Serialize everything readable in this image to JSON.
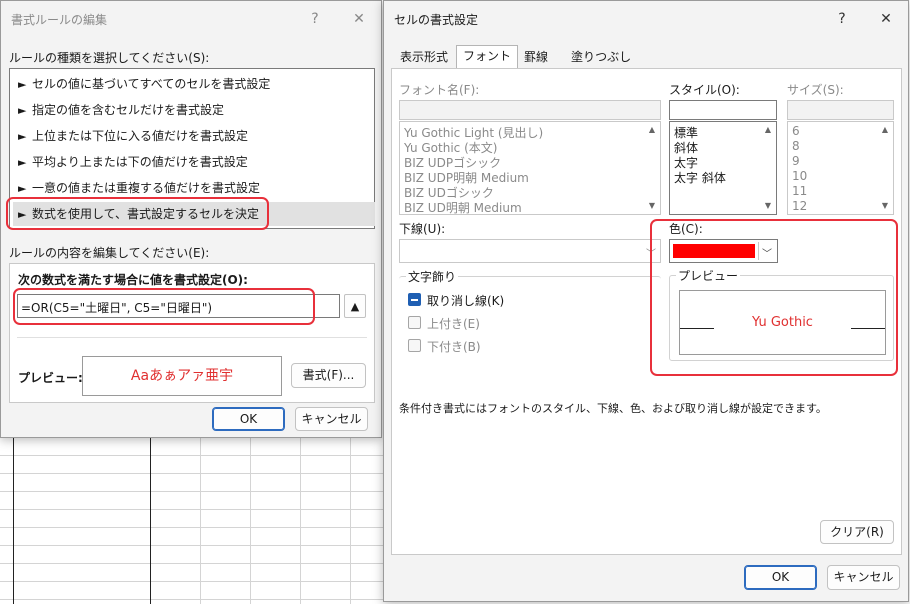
{
  "rule_dialog": {
    "title": "書式ルールの編集",
    "help": "?",
    "close": "✕",
    "rule_type_label": "ルールの種類を選択してください(S):",
    "rule_types": [
      "セルの値に基づいてすべてのセルを書式設定",
      "指定の値を含むセルだけを書式設定",
      "上位または下位に入る値だけを書式設定",
      "平均より上または下の値だけを書式設定",
      "一意の値または重複する値だけを書式設定",
      "数式を使用して、書式設定するセルを決定"
    ],
    "selected_index": 5,
    "edit_label": "ルールの内容を編集してください(E):",
    "formula_label": "次の数式を満たす場合に値を書式設定(O):",
    "formula_value": "=OR(C5=\"土曜日\", C5=\"日曜日\")",
    "preview_label": "プレビュー:",
    "preview_text": "Aaあぁアァ亜宇",
    "format_button": "書式(F)...",
    "ok": "OK",
    "cancel": "キャンセル"
  },
  "cell_dialog": {
    "title": "セルの書式設定",
    "help": "?",
    "close": "✕",
    "tabs": [
      "表示形式",
      "フォント",
      "罫線",
      "塗りつぶし"
    ],
    "active_tab": 1,
    "font_name_label": "フォント名(F):",
    "font_names": [
      "Yu Gothic Light (見出し)",
      "Yu Gothic (本文)",
      "BIZ UDPゴシック",
      "BIZ UDP明朝 Medium",
      "BIZ UDゴシック",
      "BIZ UD明朝 Medium"
    ],
    "style_label": "スタイル(O):",
    "styles": [
      "標準",
      "斜体",
      "太字",
      "太字 斜体"
    ],
    "size_label": "サイズ(S):",
    "sizes": [
      "6",
      "8",
      "9",
      "10",
      "11",
      "12"
    ],
    "underline_label": "下線(U):",
    "color_label": "色(C):",
    "color_value": "#ff0000",
    "effects_label": "文字飾り",
    "strikethrough_label": "取り消し線(K)",
    "superscript_label": "上付き(E)",
    "subscript_label": "下付き(B)",
    "preview_label": "プレビュー",
    "preview_text": "Yu Gothic",
    "info_text": "条件付き書式にはフォントのスタイル、下線、色、および取り消し線が設定できます。",
    "clear_button": "クリア(R)",
    "ok": "OK",
    "cancel": "キャンセル"
  },
  "colors": {
    "highlight_outline": "#e8303b",
    "preview_red": "#e03030",
    "accent_blue": "#1f5fb3"
  }
}
